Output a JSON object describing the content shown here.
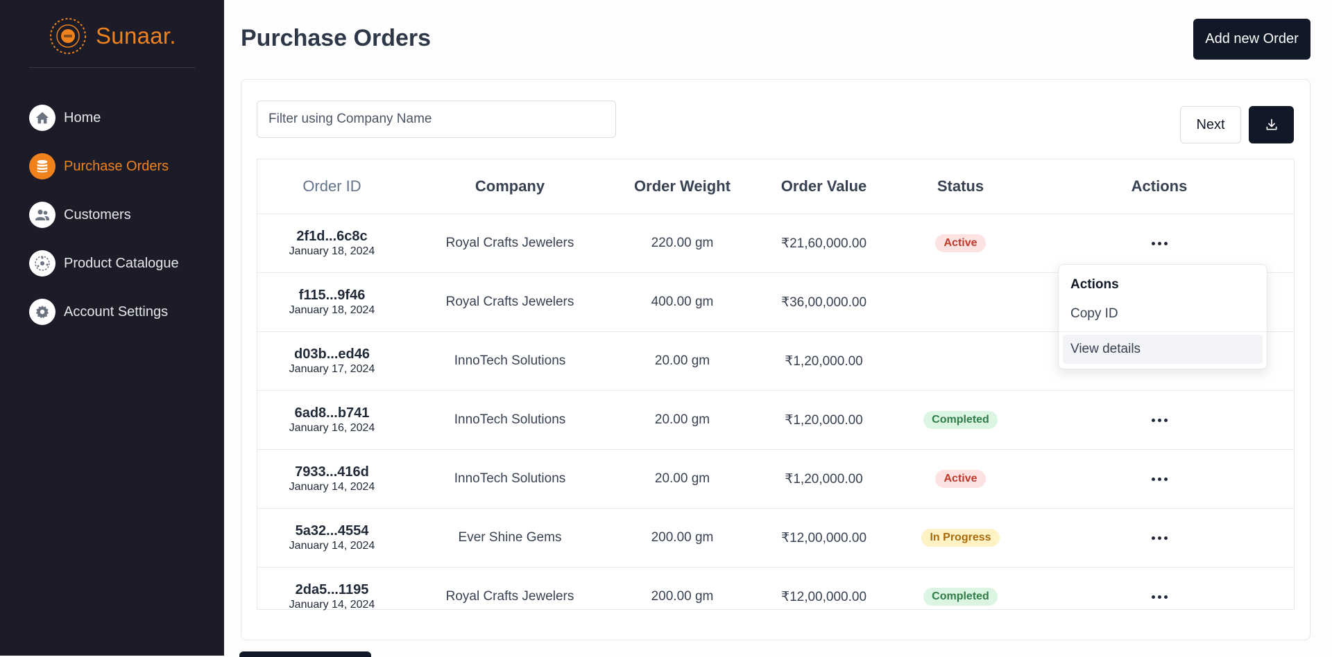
{
  "brand": {
    "name": "Sunaar.",
    "accent": "#f0821e"
  },
  "sidebar": {
    "items": [
      {
        "label": "Home",
        "icon": "home-icon",
        "active": false
      },
      {
        "label": "Purchase Orders",
        "icon": "coins-icon",
        "active": true
      },
      {
        "label": "Customers",
        "icon": "users-icon",
        "active": false
      },
      {
        "label": "Product Catalogue",
        "icon": "catalogue-icon",
        "active": false
      },
      {
        "label": "Account Settings",
        "icon": "gear-icon",
        "active": false
      }
    ]
  },
  "header": {
    "title": "Purchase Orders",
    "add_button": "Add new Order"
  },
  "filter": {
    "placeholder": "Filter using Company Name"
  },
  "pagination": {
    "next_label": "Next"
  },
  "download": {
    "icon": "download-icon"
  },
  "table": {
    "columns": [
      "Order ID",
      "Company",
      "Order Weight",
      "Order Value",
      "Status",
      "Actions"
    ],
    "rows": [
      {
        "id": "2f1d...6c8c",
        "date": "January 18, 2024",
        "company": "Royal Crafts Jewelers",
        "weight": "220.00 gm",
        "value": "₹21,60,000.00",
        "status": "Active"
      },
      {
        "id": "f115...9f46",
        "date": "January 18, 2024",
        "company": "Royal Crafts Jewelers",
        "weight": "400.00 gm",
        "value": "₹36,00,000.00",
        "status": ""
      },
      {
        "id": "d03b...ed46",
        "date": "January 17, 2024",
        "company": "InnoTech Solutions",
        "weight": "20.00 gm",
        "value": "₹1,20,000.00",
        "status": ""
      },
      {
        "id": "6ad8...b741",
        "date": "January 16, 2024",
        "company": "InnoTech Solutions",
        "weight": "20.00 gm",
        "value": "₹1,20,000.00",
        "status": "Completed"
      },
      {
        "id": "7933...416d",
        "date": "January 14, 2024",
        "company": "InnoTech Solutions",
        "weight": "20.00 gm",
        "value": "₹1,20,000.00",
        "status": "Active"
      },
      {
        "id": "5a32...4554",
        "date": "January 14, 2024",
        "company": "Ever Shine Gems",
        "weight": "200.00 gm",
        "value": "₹12,00,000.00",
        "status": "In Progress"
      },
      {
        "id": "2da5...1195",
        "date": "January 14, 2024",
        "company": "Royal Crafts Jewelers",
        "weight": "200.00 gm",
        "value": "₹12,00,000.00",
        "status": "Completed"
      }
    ]
  },
  "status_colors": {
    "Active": {
      "bg": "#fde2e2",
      "fg": "#c0392b"
    },
    "Completed": {
      "bg": "#dcf5e3",
      "fg": "#2e7d47"
    },
    "In Progress": {
      "bg": "#fdf3c4",
      "fg": "#a86a0c"
    }
  },
  "dropdown": {
    "title": "Actions",
    "items": [
      "Copy ID",
      "View details"
    ]
  }
}
